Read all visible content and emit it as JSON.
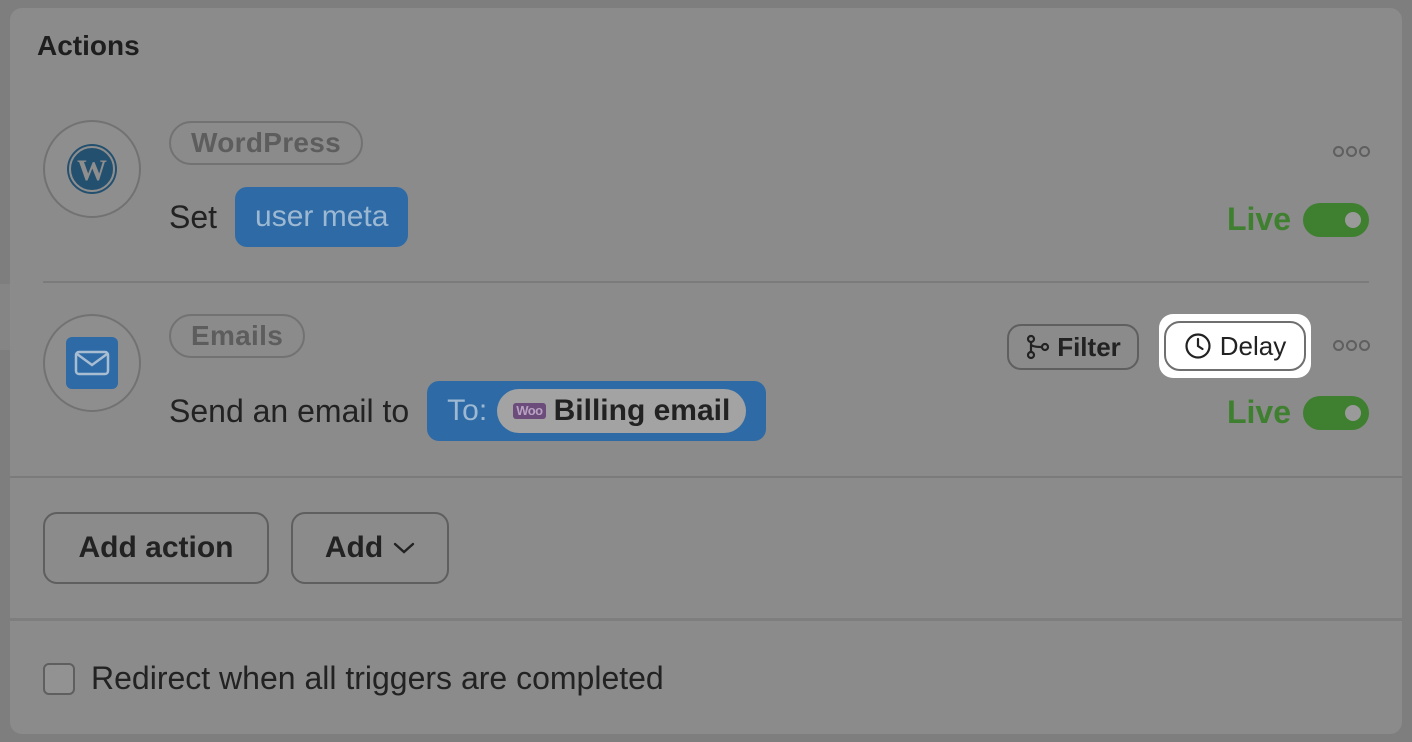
{
  "section": {
    "title": "Actions"
  },
  "actions": [
    {
      "app": "WordPress",
      "icon": "wordpress-logo-icon",
      "verb": "Set",
      "pill": "user meta",
      "status": "Live",
      "enabled": true
    },
    {
      "app": "Emails",
      "icon": "envelope-icon",
      "verb": "Send an email to",
      "pill_prefix": "To:",
      "recipient_badge": "Woo",
      "recipient": "Billing email",
      "status": "Live",
      "enabled": true,
      "filter_label": "Filter",
      "delay_label": "Delay"
    }
  ],
  "buttons": {
    "add_action": "Add action",
    "add": "Add"
  },
  "redirect": {
    "label": "Redirect when all triggers are completed",
    "checked": false
  },
  "colors": {
    "live_green": "#3f7f30",
    "pill_blue": "#2e6ba6",
    "highlight": "#ffffff"
  }
}
